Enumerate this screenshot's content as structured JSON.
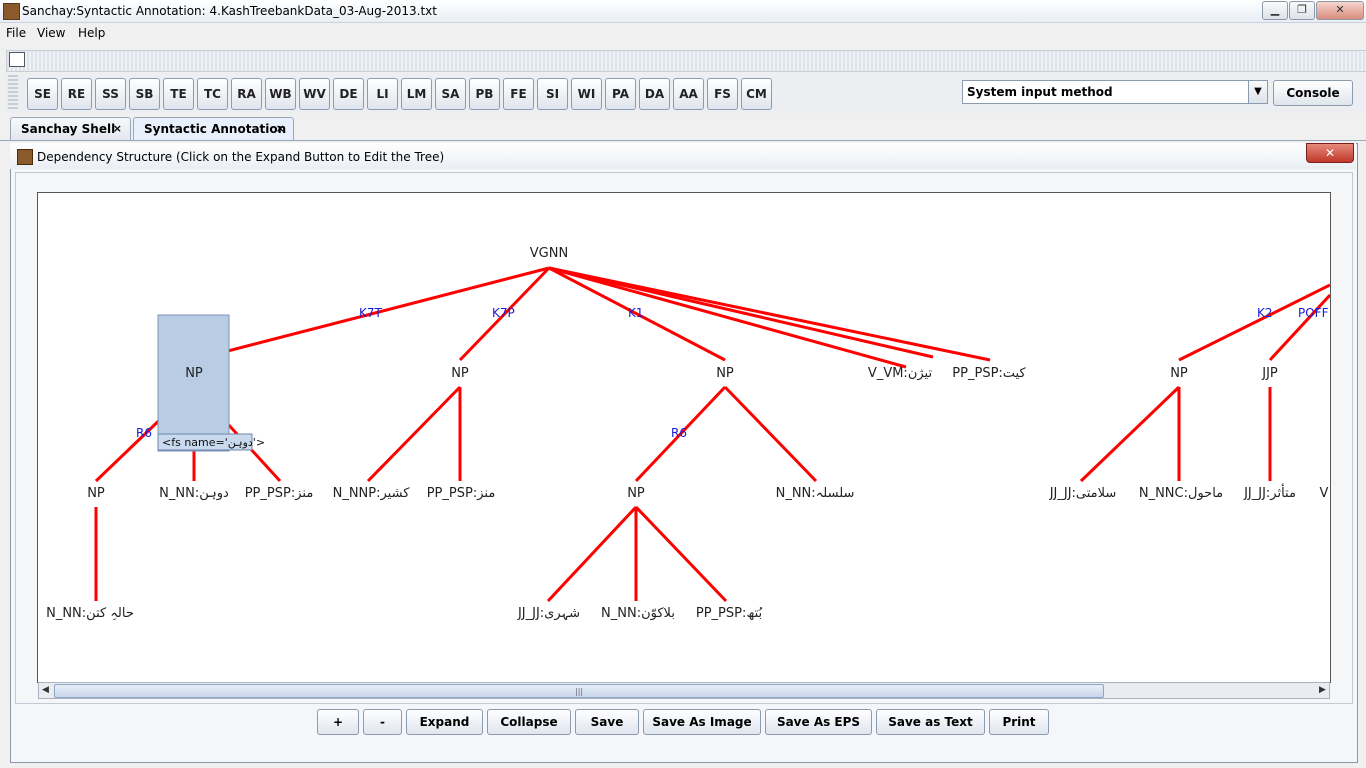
{
  "window": {
    "title": "Sanchay:Syntactic Annotation: 4.KashTreebankData_03-Aug-2013.txt",
    "minimize": "▁",
    "maximize": "❐",
    "close": "✕"
  },
  "menu": [
    "File",
    "View",
    "Help"
  ],
  "toolbar": {
    "buttons": [
      "SE",
      "RE",
      "SS",
      "SB",
      "TE",
      "TC",
      "RA",
      "WB",
      "WV",
      "DE",
      "LI",
      "LM",
      "SA",
      "PB",
      "FE",
      "SI",
      "WI",
      "PA",
      "DA",
      "AA",
      "FS",
      "CM"
    ],
    "input_method": "System input method",
    "console": "Console"
  },
  "tabs": [
    {
      "label": "Sanchay Shell",
      "close": "×"
    },
    {
      "label": "Syntactic Annotation",
      "close": "×"
    }
  ],
  "frame": {
    "title": "Dependency Structure (Click on the Expand Button to Edit the Tree)",
    "close": "✕"
  },
  "tree": {
    "root": "VGNN",
    "edges": [
      "K7T",
      "K7P",
      "K1",
      "K2",
      "POFF",
      "R6",
      "R6"
    ],
    "chunks": [
      "NP",
      "NP",
      "NP",
      "NP",
      "JJP",
      "NP",
      "NP"
    ],
    "words": [
      "V_VM:تیژن",
      "PP_PSP:کیت",
      "N_NN:دوہن",
      "PP_PSP:منز",
      "N_NNP:کشیر",
      "PP_PSP:منز",
      "N_NN:سلسلہ",
      "JJ_JJ:سلامتی",
      "N_NNC:ماحول",
      "JJ_JJ:متأثر",
      "N_NN:حالہِ کتن",
      "JJ_JJ:شہری",
      "N_NN:بلاکوّن",
      "PP_PSP:بُتھ",
      "V"
    ],
    "tooltip": "<fs name='دوہن'>"
  },
  "bottom_buttons": [
    "+",
    "-",
    "Expand",
    "Collapse",
    "Save",
    "Save As Image",
    "Save As EPS",
    "Save as Text",
    "Print"
  ],
  "scroll_grip": "|||"
}
